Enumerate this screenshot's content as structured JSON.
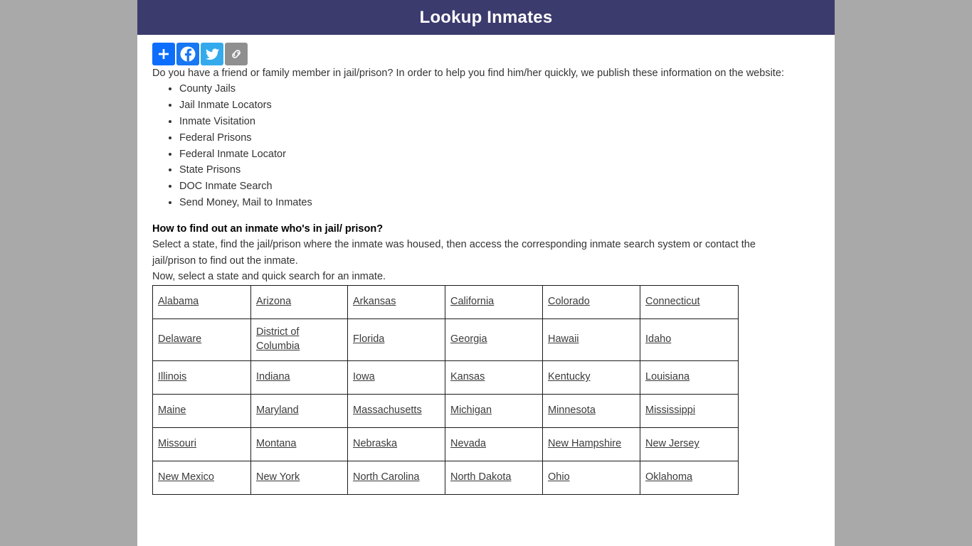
{
  "header": {
    "title": "Lookup Inmates",
    "bg_color": "#3c3b6e",
    "title_color": "#ffffff"
  },
  "page_background": "#a9a9a9",
  "share_bar": {
    "buttons": [
      {
        "name": "addthis-share-button",
        "label": "Share",
        "icon": "plus-icon",
        "color": "#0d6efd"
      },
      {
        "name": "facebook-share-button",
        "label": "Facebook",
        "icon": "facebook-icon",
        "color": "#1877f2"
      },
      {
        "name": "twitter-share-button",
        "label": "Twitter",
        "icon": "twitter-bird-icon",
        "color": "#34aaed"
      },
      {
        "name": "copy-link-button",
        "label": "Copy Link",
        "icon": "link-chain-icon",
        "color": "#8f8f8f"
      }
    ]
  },
  "content": {
    "intro_paragraph": "Do you have a friend or family member in jail/prison? In order to help you find him/her quickly, we publish these information on the website:",
    "feature_list": [
      "County Jails",
      "Jail Inmate Locators",
      "Inmate Visitation",
      "Federal Prisons",
      "Federal Inmate Locator",
      "State Prisons",
      "DOC Inmate Search",
      "Send Money, Mail to Inmates"
    ],
    "howto_heading": "How to find out an inmate who's in jail/ prison?",
    "howto_body": "Select a state, find the jail/prison where the inmate was housed, then access the corresponding inmate search system or contact the jail/prison to find out the inmate.",
    "now_select": "Now, select a state and quick search for an inmate."
  },
  "state_table": {
    "link_color": "#3b3b3b",
    "border_color": "#1b1b1b",
    "rows": [
      [
        "Alabama",
        "Arizona",
        "Arkansas",
        "California",
        "Colorado",
        "Connecticut"
      ],
      [
        "Delaware",
        "District of Columbia",
        "Florida",
        "Georgia",
        "Hawaii",
        "Idaho"
      ],
      [
        "Illinois",
        "Indiana",
        "Iowa",
        "Kansas",
        "Kentucky",
        "Louisiana"
      ],
      [
        "Maine",
        "Maryland",
        "Massachusetts",
        "Michigan",
        "Minnesota",
        "Mississippi"
      ],
      [
        "Missouri",
        "Montana",
        "Nebraska",
        "Nevada",
        "New Hampshire",
        "New Jersey"
      ],
      [
        "New Mexico",
        "New York",
        "North Carolina",
        "North Dakota",
        "Ohio",
        "Oklahoma"
      ]
    ]
  }
}
